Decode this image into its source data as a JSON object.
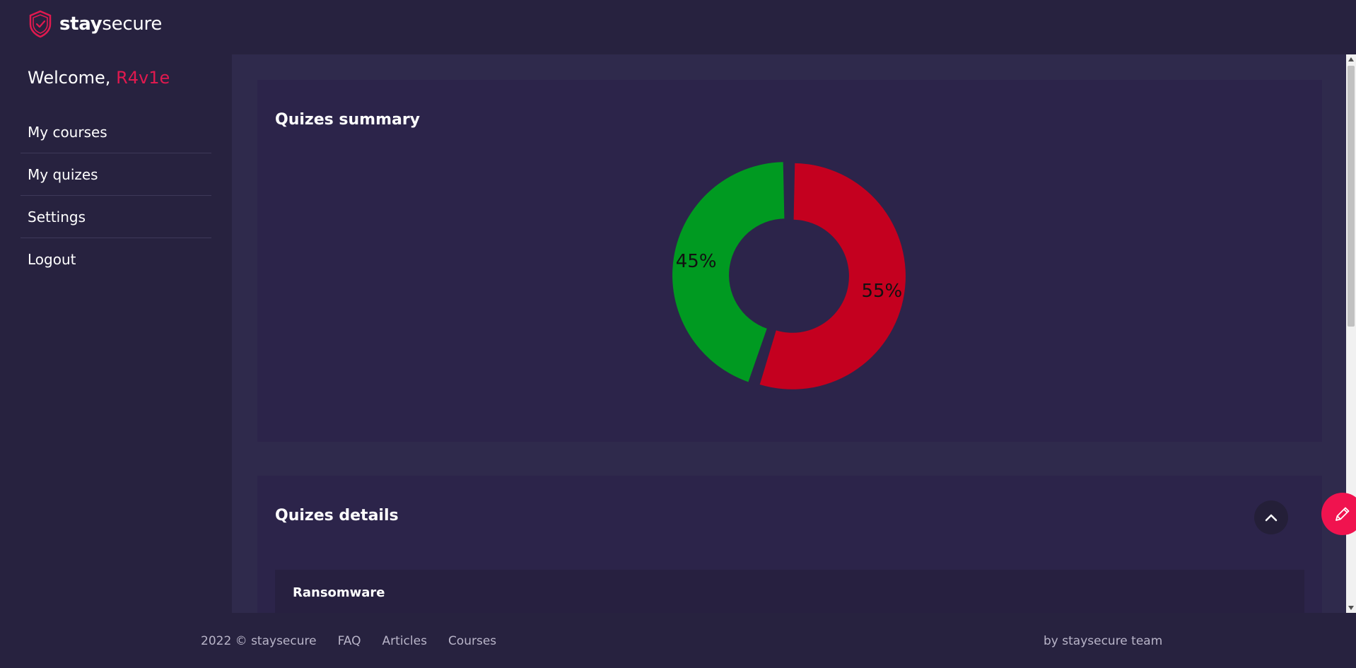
{
  "brand": {
    "name_bold": "stay",
    "name_light": "secure",
    "accent": "#e0194f"
  },
  "sidebar": {
    "welcome": "Welcome,",
    "username": "R4v1e",
    "items": [
      {
        "label": "My courses"
      },
      {
        "label": "My quizes"
      },
      {
        "label": "Settings"
      },
      {
        "label": "Logout"
      }
    ]
  },
  "summary": {
    "title": "Quizes summary"
  },
  "chart_data": {
    "type": "pie",
    "donut": true,
    "title": "Quizes summary",
    "slices": [
      {
        "value": 55,
        "label": "55%",
        "color": "#c4001f"
      },
      {
        "value": 45,
        "label": "45%",
        "color": "#009a21"
      }
    ]
  },
  "details": {
    "title": "Quizes details",
    "toggle_icon": "chevron-up-icon",
    "items": [
      {
        "name": "Ransomware"
      }
    ]
  },
  "fab": {
    "icon": "pencil-icon",
    "color": "#f0134f"
  },
  "footer": {
    "copyright": "2022 © staysecure",
    "links": [
      {
        "label": "FAQ"
      },
      {
        "label": "Articles"
      },
      {
        "label": "Courses"
      }
    ],
    "credit": "by staysecure team"
  }
}
